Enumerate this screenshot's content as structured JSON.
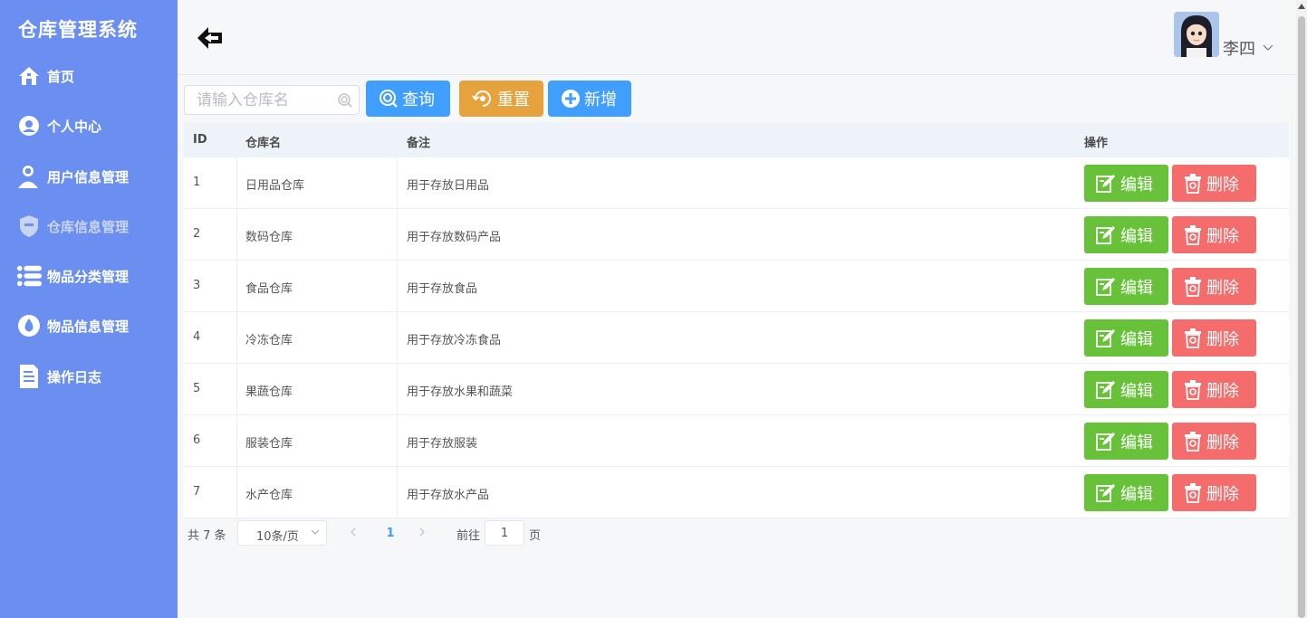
{
  "sidebar": {
    "brand": "仓库管理系统",
    "items": [
      {
        "label": "首页",
        "icon": "home-icon"
      },
      {
        "label": "个人中心",
        "icon": "user-circle-icon"
      },
      {
        "label": "用户信息管理",
        "icon": "user-add-icon"
      },
      {
        "label": "仓库信息管理",
        "icon": "shield-icon"
      },
      {
        "label": "物品分类管理",
        "icon": "list-icon"
      },
      {
        "label": "物品信息管理",
        "icon": "drop-icon"
      },
      {
        "label": "操作日志",
        "icon": "document-icon"
      }
    ],
    "active_index": 3
  },
  "header": {
    "back_icon": "back-arrow-icon",
    "user_name": "李四"
  },
  "toolbar": {
    "search_placeholder": "请输入仓库名",
    "query_label": "查询",
    "reset_label": "重置",
    "add_label": "新增"
  },
  "table": {
    "columns": [
      "ID",
      "仓库名",
      "备注",
      "操作"
    ],
    "rows": [
      {
        "id": "1",
        "name": "日用品仓库",
        "note": "用于存放日用品"
      },
      {
        "id": "2",
        "name": "数码仓库",
        "note": "用于存放数码产品"
      },
      {
        "id": "3",
        "name": "食品仓库",
        "note": "用于存放食品"
      },
      {
        "id": "4",
        "name": "冷冻仓库",
        "note": "用于存放冷冻食品"
      },
      {
        "id": "5",
        "name": "果蔬仓库",
        "note": "用于存放水果和蔬菜"
      },
      {
        "id": "6",
        "name": "服装仓库",
        "note": "用于存放服装"
      },
      {
        "id": "7",
        "name": "水产仓库",
        "note": "用于存放水产品"
      }
    ],
    "edit_label": "编辑",
    "delete_label": "删除"
  },
  "pagination": {
    "total_text": "共 7 条",
    "page_size": "10条/页",
    "current_page": "1",
    "goto_label": "前往",
    "goto_value": "1",
    "page_suffix": "页"
  },
  "colors": {
    "sidebar_bg": "#6a8ff0",
    "primary": "#409eff",
    "warning": "#e6a23c",
    "success": "#67c23a",
    "danger": "#f56c6c"
  }
}
